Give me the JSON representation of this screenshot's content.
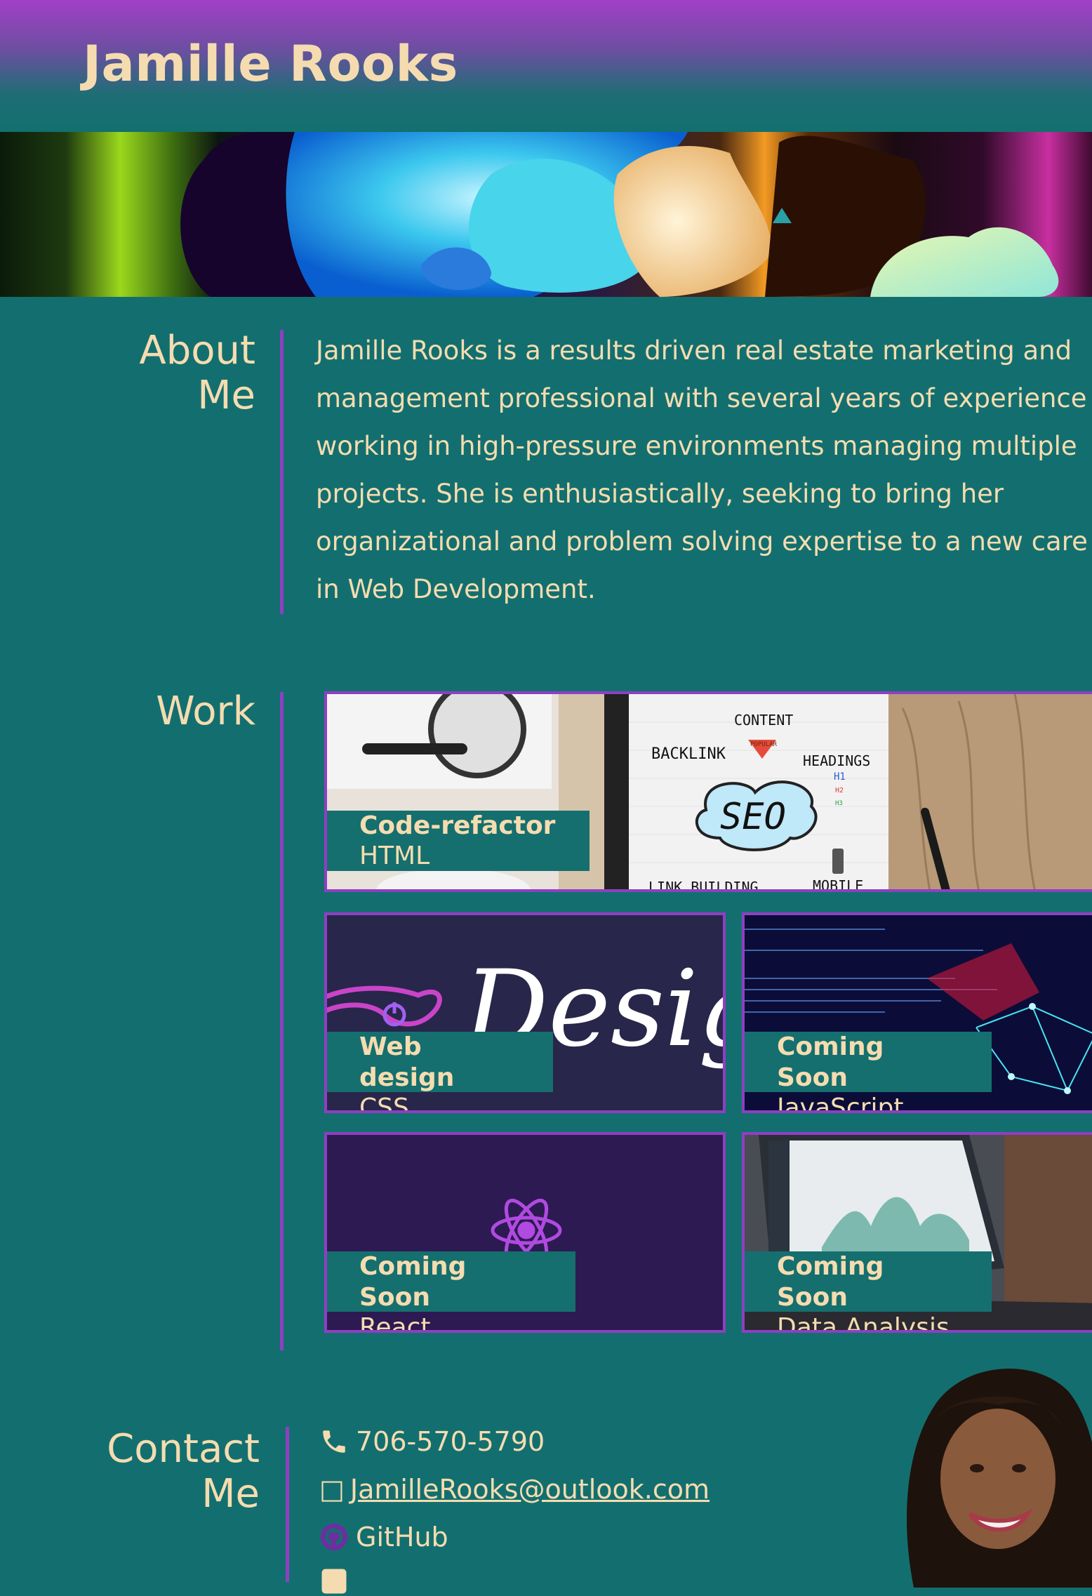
{
  "header": {
    "title": "Jamille Rooks"
  },
  "about": {
    "heading_line1": "About",
    "heading_line2": "Me",
    "lines": [
      "Jamille Rooks is a results driven real estate marketing and",
      "management professional with several years of experience",
      "working in high-pressure environments managing multiple",
      "projects. She is enthusiastically, seeking to bring her",
      "organizational and problem solving expertise to a new care",
      "in Web Development."
    ]
  },
  "work": {
    "heading": "Work",
    "cards": [
      {
        "title": "Code-refactor",
        "subtitle": "HTML",
        "image_words": [
          "CONTENT",
          "POPULAR",
          "BACKLINK",
          "HEADINGS",
          "H1",
          "H2",
          "H3",
          "SEO",
          "LINK BUILDING",
          "MOBILE"
        ]
      },
      {
        "title": "Web design",
        "subtitle": "CSS",
        "image_word": "Design"
      },
      {
        "title": "Coming Soon",
        "subtitle": "JavaScript"
      },
      {
        "title": "Coming Soon",
        "subtitle": "React"
      },
      {
        "title": "Coming Soon",
        "subtitle": "Data Analysis"
      }
    ]
  },
  "contact": {
    "heading_line1": "Contact",
    "heading_line2": "Me",
    "phone": "706-570-5790",
    "email_glyph": "□",
    "email": "JamilleRooks@outlook.com",
    "github": "GitHub"
  },
  "colors": {
    "bg": "#136f6f",
    "accent": "#8f3fc2",
    "text": "#f5dcb0",
    "header_top": "#a23fc8"
  },
  "icons": [
    "phone-icon",
    "email-icon",
    "github-icon",
    "linkedin-icon"
  ]
}
